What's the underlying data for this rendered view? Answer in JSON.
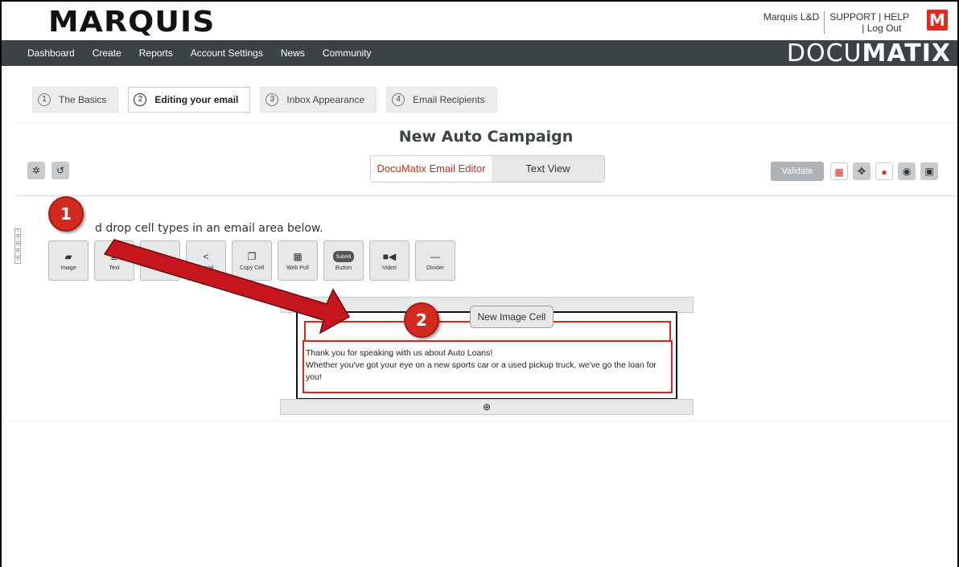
{
  "header": {
    "logo": "MARQUIS",
    "user_name": "Marquis L&D",
    "support_link": "SUPPORT",
    "help_link": "HELP",
    "logout_link": "Log Out",
    "badge": "M",
    "brand_light": "DOCU",
    "brand_bold": "MATIX"
  },
  "nav": {
    "items": [
      "Dashboard",
      "Create",
      "Reports",
      "Account Settings",
      "News",
      "Community"
    ]
  },
  "steps": [
    {
      "num": "1",
      "label": "The Basics"
    },
    {
      "num": "2",
      "label": "Editing your email"
    },
    {
      "num": "3",
      "label": "Inbox Appearance"
    },
    {
      "num": "4",
      "label": "Email Recipients"
    }
  ],
  "editor": {
    "campaign_title": "New Auto Campaign",
    "mode_active": "DocuMatix Email Editor",
    "mode_inactive": "Text View",
    "validate_label": "Validate"
  },
  "toolbar": {
    "hint": "d drop cell types in an email area below.",
    "cell_types": [
      {
        "icon": "▰",
        "label": "Image"
      },
      {
        "icon": "≣",
        "label": "Text"
      },
      {
        "icon": "≣▰",
        "label": ""
      },
      {
        "icon": "<",
        "label": "Social"
      },
      {
        "icon": "❐",
        "label": "Copy Cell"
      },
      {
        "icon": "▦",
        "label": "Web Poll"
      },
      {
        "icon": "Submit",
        "label": "Button"
      },
      {
        "icon": "■◀",
        "label": "Video"
      },
      {
        "icon": "—",
        "label": "Divider"
      }
    ]
  },
  "email": {
    "tooltip": "New Image Cell",
    "line1": "Thank you for speaking with us about Auto Loans!",
    "line2": "Whether you've got your eye on a new sports car or a used pickup truck, we've go the loan for you!"
  },
  "callouts": [
    "1",
    "2"
  ],
  "colors": {
    "accent_red": "#d32a20",
    "nav_bg": "#3c4347"
  }
}
